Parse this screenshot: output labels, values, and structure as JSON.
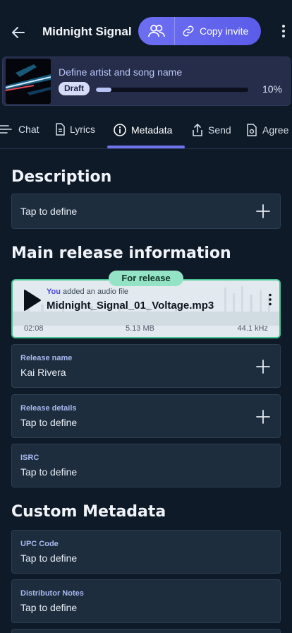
{
  "header": {
    "title": "Midnight Signal",
    "copy_invite": "Copy invite"
  },
  "draft": {
    "title": "Define artist and song name",
    "status": "Draft",
    "progress_text": "10%",
    "progress": 0.1
  },
  "tabs": [
    {
      "label": "Chat"
    },
    {
      "label": "Lyrics"
    },
    {
      "label": "Metadata"
    },
    {
      "label": "Send"
    },
    {
      "label": "Agree"
    }
  ],
  "description": {
    "heading": "Description",
    "placeholder": "Tap to define"
  },
  "main_release": {
    "heading": "Main release information",
    "audio": {
      "badge": "For release",
      "actor": "You",
      "action": "added an audio file",
      "filename": "Midnight_Signal_01_Voltage.mp3",
      "duration": "02:08",
      "size": "5.13 MB",
      "sample_rate": "44.1 kHz"
    },
    "release_name": {
      "label": "Release name",
      "value": "Kai Rivera"
    },
    "release_details": {
      "label": "Release details",
      "value": "Tap to define"
    },
    "isrc": {
      "label": "ISRC",
      "value": "Tap to define"
    }
  },
  "custom": {
    "heading": "Custom Metadata",
    "upc": {
      "label": "UPC Code",
      "value": "Tap to define"
    },
    "distributor": {
      "label": "Distributor Notes",
      "value": "Tap to define"
    }
  },
  "colors": {
    "accent": "#6d6ff2",
    "background": "#0f1a28",
    "release_green": "#47c491"
  }
}
